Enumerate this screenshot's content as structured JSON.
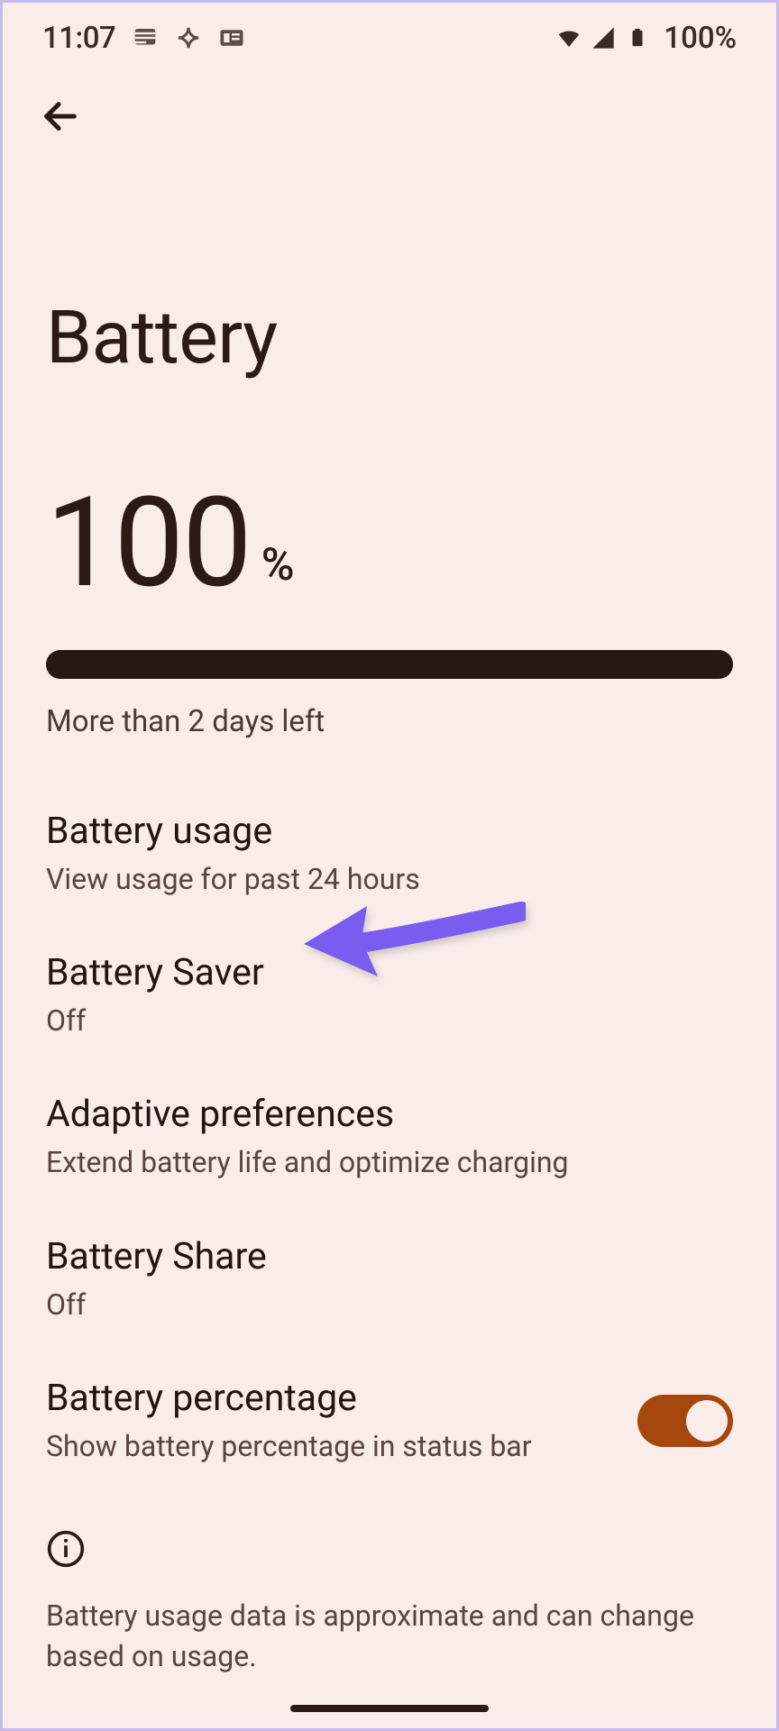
{
  "status": {
    "time": "11:07",
    "battery_label": "100%"
  },
  "header": {
    "title": "Battery"
  },
  "battery": {
    "level": "100",
    "symbol": "%",
    "estimate": "More than 2 days left",
    "fill_percent": 100
  },
  "items": [
    {
      "title": "Battery usage",
      "subtitle": "View usage for past 24 hours"
    },
    {
      "title": "Battery Saver",
      "subtitle": "Off"
    },
    {
      "title": "Adaptive preferences",
      "subtitle": "Extend battery life and optimize charging"
    },
    {
      "title": "Battery Share",
      "subtitle": "Off"
    },
    {
      "title": "Battery percentage",
      "subtitle": "Show battery percentage in status bar",
      "switch_on": true
    }
  ],
  "footer": {
    "text": "Battery usage data is approximate and can change based on usage."
  }
}
